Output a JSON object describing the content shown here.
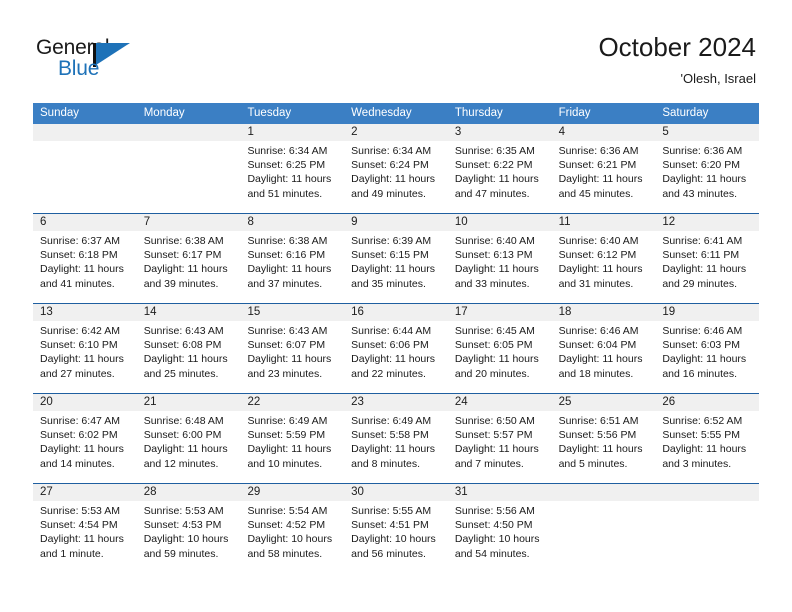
{
  "brand": {
    "name_general": "General",
    "name_blue": "Blue",
    "flag_color": "#1e72b8"
  },
  "header": {
    "title": "October 2024",
    "location": "'Olesh, Israel"
  },
  "calendar": {
    "header_bg": "#3b7fc4",
    "week_separator_color": "#1f5fa0",
    "band_bg": "#f0f0f0",
    "weekdays": [
      "Sunday",
      "Monday",
      "Tuesday",
      "Wednesday",
      "Thursday",
      "Friday",
      "Saturday"
    ],
    "weeks": [
      [
        {
          "day": "",
          "empty": true
        },
        {
          "day": "",
          "empty": true
        },
        {
          "day": "1",
          "sunrise": "Sunrise: 6:34 AM",
          "sunset": "Sunset: 6:25 PM",
          "daylight1": "Daylight: 11 hours",
          "daylight2": "and 51 minutes."
        },
        {
          "day": "2",
          "sunrise": "Sunrise: 6:34 AM",
          "sunset": "Sunset: 6:24 PM",
          "daylight1": "Daylight: 11 hours",
          "daylight2": "and 49 minutes."
        },
        {
          "day": "3",
          "sunrise": "Sunrise: 6:35 AM",
          "sunset": "Sunset: 6:22 PM",
          "daylight1": "Daylight: 11 hours",
          "daylight2": "and 47 minutes."
        },
        {
          "day": "4",
          "sunrise": "Sunrise: 6:36 AM",
          "sunset": "Sunset: 6:21 PM",
          "daylight1": "Daylight: 11 hours",
          "daylight2": "and 45 minutes."
        },
        {
          "day": "5",
          "sunrise": "Sunrise: 6:36 AM",
          "sunset": "Sunset: 6:20 PM",
          "daylight1": "Daylight: 11 hours",
          "daylight2": "and 43 minutes."
        }
      ],
      [
        {
          "day": "6",
          "sunrise": "Sunrise: 6:37 AM",
          "sunset": "Sunset: 6:18 PM",
          "daylight1": "Daylight: 11 hours",
          "daylight2": "and 41 minutes."
        },
        {
          "day": "7",
          "sunrise": "Sunrise: 6:38 AM",
          "sunset": "Sunset: 6:17 PM",
          "daylight1": "Daylight: 11 hours",
          "daylight2": "and 39 minutes."
        },
        {
          "day": "8",
          "sunrise": "Sunrise: 6:38 AM",
          "sunset": "Sunset: 6:16 PM",
          "daylight1": "Daylight: 11 hours",
          "daylight2": "and 37 minutes."
        },
        {
          "day": "9",
          "sunrise": "Sunrise: 6:39 AM",
          "sunset": "Sunset: 6:15 PM",
          "daylight1": "Daylight: 11 hours",
          "daylight2": "and 35 minutes."
        },
        {
          "day": "10",
          "sunrise": "Sunrise: 6:40 AM",
          "sunset": "Sunset: 6:13 PM",
          "daylight1": "Daylight: 11 hours",
          "daylight2": "and 33 minutes."
        },
        {
          "day": "11",
          "sunrise": "Sunrise: 6:40 AM",
          "sunset": "Sunset: 6:12 PM",
          "daylight1": "Daylight: 11 hours",
          "daylight2": "and 31 minutes."
        },
        {
          "day": "12",
          "sunrise": "Sunrise: 6:41 AM",
          "sunset": "Sunset: 6:11 PM",
          "daylight1": "Daylight: 11 hours",
          "daylight2": "and 29 minutes."
        }
      ],
      [
        {
          "day": "13",
          "sunrise": "Sunrise: 6:42 AM",
          "sunset": "Sunset: 6:10 PM",
          "daylight1": "Daylight: 11 hours",
          "daylight2": "and 27 minutes."
        },
        {
          "day": "14",
          "sunrise": "Sunrise: 6:43 AM",
          "sunset": "Sunset: 6:08 PM",
          "daylight1": "Daylight: 11 hours",
          "daylight2": "and 25 minutes."
        },
        {
          "day": "15",
          "sunrise": "Sunrise: 6:43 AM",
          "sunset": "Sunset: 6:07 PM",
          "daylight1": "Daylight: 11 hours",
          "daylight2": "and 23 minutes."
        },
        {
          "day": "16",
          "sunrise": "Sunrise: 6:44 AM",
          "sunset": "Sunset: 6:06 PM",
          "daylight1": "Daylight: 11 hours",
          "daylight2": "and 22 minutes."
        },
        {
          "day": "17",
          "sunrise": "Sunrise: 6:45 AM",
          "sunset": "Sunset: 6:05 PM",
          "daylight1": "Daylight: 11 hours",
          "daylight2": "and 20 minutes."
        },
        {
          "day": "18",
          "sunrise": "Sunrise: 6:46 AM",
          "sunset": "Sunset: 6:04 PM",
          "daylight1": "Daylight: 11 hours",
          "daylight2": "and 18 minutes."
        },
        {
          "day": "19",
          "sunrise": "Sunrise: 6:46 AM",
          "sunset": "Sunset: 6:03 PM",
          "daylight1": "Daylight: 11 hours",
          "daylight2": "and 16 minutes."
        }
      ],
      [
        {
          "day": "20",
          "sunrise": "Sunrise: 6:47 AM",
          "sunset": "Sunset: 6:02 PM",
          "daylight1": "Daylight: 11 hours",
          "daylight2": "and 14 minutes."
        },
        {
          "day": "21",
          "sunrise": "Sunrise: 6:48 AM",
          "sunset": "Sunset: 6:00 PM",
          "daylight1": "Daylight: 11 hours",
          "daylight2": "and 12 minutes."
        },
        {
          "day": "22",
          "sunrise": "Sunrise: 6:49 AM",
          "sunset": "Sunset: 5:59 PM",
          "daylight1": "Daylight: 11 hours",
          "daylight2": "and 10 minutes."
        },
        {
          "day": "23",
          "sunrise": "Sunrise: 6:49 AM",
          "sunset": "Sunset: 5:58 PM",
          "daylight1": "Daylight: 11 hours",
          "daylight2": "and 8 minutes."
        },
        {
          "day": "24",
          "sunrise": "Sunrise: 6:50 AM",
          "sunset": "Sunset: 5:57 PM",
          "daylight1": "Daylight: 11 hours",
          "daylight2": "and 7 minutes."
        },
        {
          "day": "25",
          "sunrise": "Sunrise: 6:51 AM",
          "sunset": "Sunset: 5:56 PM",
          "daylight1": "Daylight: 11 hours",
          "daylight2": "and 5 minutes."
        },
        {
          "day": "26",
          "sunrise": "Sunrise: 6:52 AM",
          "sunset": "Sunset: 5:55 PM",
          "daylight1": "Daylight: 11 hours",
          "daylight2": "and 3 minutes."
        }
      ],
      [
        {
          "day": "27",
          "sunrise": "Sunrise: 5:53 AM",
          "sunset": "Sunset: 4:54 PM",
          "daylight1": "Daylight: 11 hours",
          "daylight2": "and 1 minute."
        },
        {
          "day": "28",
          "sunrise": "Sunrise: 5:53 AM",
          "sunset": "Sunset: 4:53 PM",
          "daylight1": "Daylight: 10 hours",
          "daylight2": "and 59 minutes."
        },
        {
          "day": "29",
          "sunrise": "Sunrise: 5:54 AM",
          "sunset": "Sunset: 4:52 PM",
          "daylight1": "Daylight: 10 hours",
          "daylight2": "and 58 minutes."
        },
        {
          "day": "30",
          "sunrise": "Sunrise: 5:55 AM",
          "sunset": "Sunset: 4:51 PM",
          "daylight1": "Daylight: 10 hours",
          "daylight2": "and 56 minutes."
        },
        {
          "day": "31",
          "sunrise": "Sunrise: 5:56 AM",
          "sunset": "Sunset: 4:50 PM",
          "daylight1": "Daylight: 10 hours",
          "daylight2": "and 54 minutes."
        },
        {
          "day": "",
          "empty": true
        },
        {
          "day": "",
          "empty": true
        }
      ]
    ]
  }
}
